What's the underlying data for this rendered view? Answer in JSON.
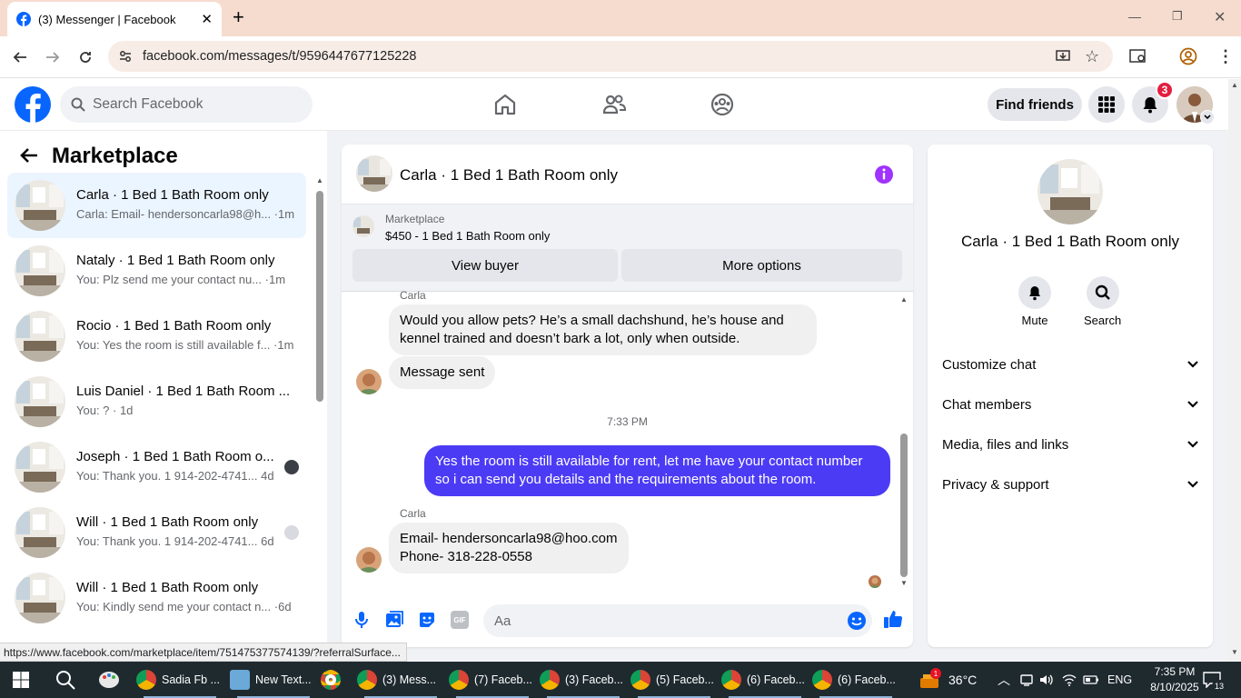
{
  "browser": {
    "tab_title": "(3) Messenger | Facebook",
    "new_tab": "+",
    "url": "facebook.com/messages/t/9596447677125228",
    "status_url": "https://www.facebook.com/marketplace/item/751475377574139/?referralSurface..."
  },
  "facebook": {
    "search_placeholder": "Search Facebook",
    "find_friends": "Find friends",
    "notification_count": "3"
  },
  "left_panel": {
    "title": "Marketplace",
    "conversations": [
      {
        "name": "Carla · 1 Bed 1 Bath Room only",
        "preview": "Carla: Email- hendersoncarla98@h... ·1m",
        "active": true
      },
      {
        "name": "Nataly · 1 Bed 1 Bath Room only",
        "preview": "You: Plz send me your contact nu...  ·1m"
      },
      {
        "name": "Rocio · 1 Bed 1 Bath Room only",
        "preview": "You: Yes the room is still available f...  ·1m"
      },
      {
        "name": "Luis Daniel · 1 Bed 1 Bath Room ...",
        "preview": "You: ? · 1d"
      },
      {
        "name": "Joseph · 1 Bed 1 Bath Room o...",
        "preview": "You: Thank you. 1 914-202-4741...  4d"
      },
      {
        "name": "Will · 1 Bed 1 Bath Room only",
        "preview": "You: Thank you. 1 914-202-4741...  6d"
      },
      {
        "name": "Will · 1 Bed 1 Bath Room only",
        "preview": "You: Kindly send me your contact n... ·6d"
      }
    ]
  },
  "chat": {
    "title": "Carla · 1 Bed 1 Bath Room only",
    "marketplace_label": "Marketplace",
    "listing": "$450 - 1 Bed 1 Bath Room only",
    "view_buyer": "View buyer",
    "more_options": "More options",
    "sender_top": "Carla",
    "msg1": "Would you allow pets? He’s a small dachshund, he’s house and kennel trained and doesn’t bark a lot, only when outside.",
    "msg2": "Message sent",
    "timestamp": "7:33 PM",
    "msg3": "Yes the room is still available for rent, let me have your contact number so i can send you details and the requirements about the room.",
    "sender_bottom": "Carla",
    "msg4_line1": "Email- hendersoncarla98@hoo.com",
    "msg4_line2": "Phone- 318-228-0558",
    "composer_placeholder": "Aa"
  },
  "right_panel": {
    "name": "Carla · 1 Bed 1 Bath Room only",
    "mute": "Mute",
    "search": "Search",
    "sections": [
      "Customize chat",
      "Chat members",
      "Media, files and links",
      "Privacy & support"
    ]
  },
  "taskbar": {
    "items": [
      "Sadia Fb ...",
      "New Text...",
      "(3) Mess...",
      "(7) Faceb...",
      "(3) Faceb...",
      "(5) Faceb...",
      "(6) Faceb...",
      "(6) Faceb..."
    ],
    "weather": "36°C",
    "language": "ENG",
    "time": "7:35 PM",
    "date": "8/10/2025",
    "notifications": "13",
    "weather_badge": "1"
  },
  "colors": {
    "facebook_blue": "#0866ff",
    "accent_purple": "#a033ff",
    "outgoing_bubble": "#4c3bf5"
  }
}
